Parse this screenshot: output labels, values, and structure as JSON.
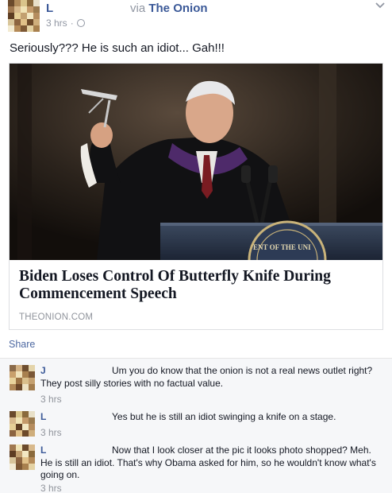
{
  "post": {
    "author": "L",
    "via_prefix": "via",
    "via_source": "The Onion",
    "time": "3 hrs",
    "separator": "·",
    "text": "Seriously??? He is such an idiot... Gah!!!"
  },
  "link": {
    "title": "Biden Loses Control Of Butterfly Knife During Commencement Speech",
    "domain": "THEONION.COM",
    "podium_seal_text": "ENT OF THE UNI"
  },
  "actions": {
    "share_label": "Share"
  },
  "comments": [
    {
      "author": "J",
      "text": "Um you do know that the onion is not a real news outlet right? They post silly stories with no factual value.",
      "time": "3 hrs"
    },
    {
      "author": "L",
      "text": "Yes but he is still an idiot swinging a knife on a stage.",
      "time": "3 hrs"
    },
    {
      "author": "L",
      "text": "Now that I look closer at the pic it looks photo shopped? Meh. He is still an idiot. That's why Obama asked for him, so he wouldn't know what's going on.",
      "time": "3 hrs"
    }
  ],
  "colors": {
    "link_blue": "#3b5998",
    "meta_gray": "#9197a3",
    "comment_bg": "#f6f7f9"
  },
  "icons": {
    "visibility": "globe-icon",
    "options": "chevron-down-icon"
  }
}
